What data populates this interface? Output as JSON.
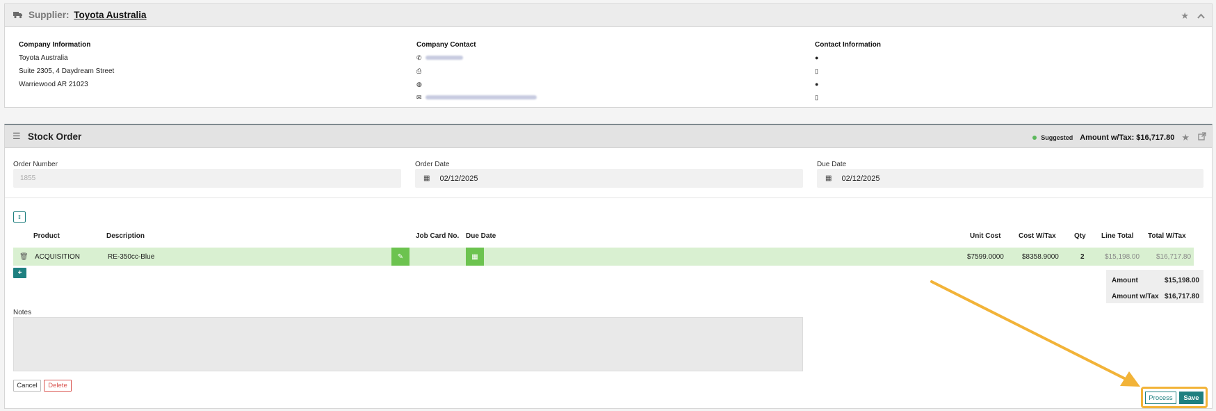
{
  "supplier": {
    "label": "Supplier:",
    "name": "Toyota Australia",
    "company_info": {
      "heading": "Company Information",
      "name": "Toyota Australia",
      "address1": "Suite 2305, 4 Daydream Street",
      "address2": "Warriewood AR 21023"
    },
    "company_contact": {
      "heading": "Company Contact"
    },
    "contact_info": {
      "heading": "Contact Information"
    }
  },
  "order": {
    "title": "Stock Order",
    "status": "Suggested",
    "amount_tax_header": "Amount w/Tax: $16,717.80",
    "order_number_label": "Order Number",
    "order_number_value": "1855",
    "order_date_label": "Order Date",
    "order_date_value": "02/12/2025",
    "due_date_label": "Due Date",
    "due_date_value": "02/12/2025",
    "columns": {
      "product": "Product",
      "description": "Description",
      "job_card": "Job Card No.",
      "due_date": "Due Date",
      "unit_cost": "Unit Cost",
      "cost_tax": "Cost W/Tax",
      "qty": "Qty",
      "line_total": "Line Total",
      "total_tax": "Total W/Tax"
    },
    "line": {
      "product": "ACQUISITION",
      "description": "RE-350cc-Blue",
      "unit_cost": "$7599.0000",
      "cost_tax": "$8358.9000",
      "qty": "2",
      "line_total": "$15,198.00",
      "total_tax": "$16,717.80"
    },
    "totals": {
      "amount_label": "Amount",
      "amount_value": "$15,198.00",
      "amount_tax_label": "Amount w/Tax",
      "amount_tax_value": "$16,717.80"
    },
    "notes_label": "Notes",
    "buttons": {
      "cancel": "Cancel",
      "delete": "Delete",
      "process": "Process",
      "save": "Save"
    }
  },
  "colors": {
    "accent": "#1e8080",
    "row_bg": "#d9f0d1",
    "green_button": "#6cc34f",
    "highlight": "#f2b338",
    "delete": "#d9534f"
  }
}
